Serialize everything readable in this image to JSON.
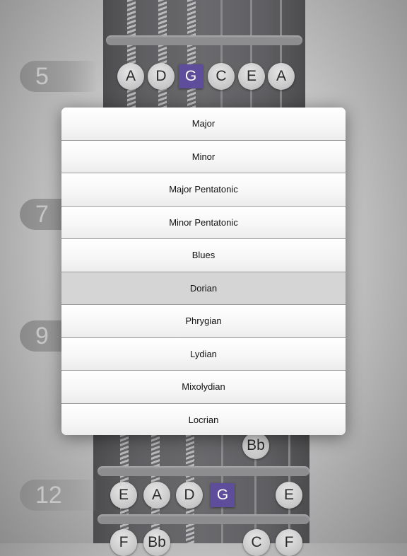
{
  "fret_labels": {
    "f5": "5",
    "f7": "7",
    "f9": "9",
    "f12": "12"
  },
  "notes": {
    "row5": [
      "A",
      "D",
      "G",
      "C",
      "E",
      "A"
    ],
    "row11": [
      "Bb"
    ],
    "row12": [
      "E",
      "A",
      "D",
      "G",
      "E"
    ],
    "row13": [
      "F",
      "Bb",
      "C",
      "F"
    ]
  },
  "root_note": "G",
  "colors": {
    "root_highlight": "#5e4d9b",
    "selected_item": "#d5d5d5"
  },
  "scale_menu": {
    "selected": "Dorian",
    "items": [
      "Major",
      "Minor",
      "Major Pentatonic",
      "Minor Pentatonic",
      "Blues",
      "Dorian",
      "Phrygian",
      "Lydian",
      "Mixolydian",
      "Locrian"
    ]
  }
}
